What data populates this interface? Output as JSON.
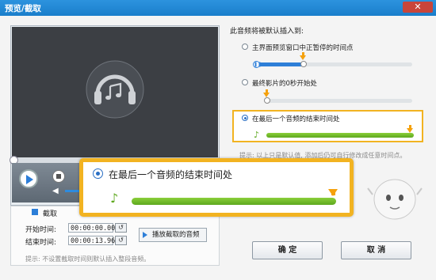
{
  "window": {
    "title": "预览/截取",
    "close_icon": "close-icon"
  },
  "clip": {
    "tab_label": "截取",
    "start_label": "开始时间:",
    "start_value": "00:00:00.000",
    "end_label": "结束时间:",
    "end_value": "00:00:13.960",
    "play_button": "播放截取的音频",
    "hint": "提示: 不设置截取时间则默认插入整段音频。"
  },
  "insert": {
    "section_title": "此音频将被默认插入到:",
    "options": [
      {
        "label": "主界面预览窗口中正暂停的时间点",
        "selected": false
      },
      {
        "label": "最终影片的0秒开始处",
        "selected": false
      },
      {
        "label": "在最后一个音频的结束时间处",
        "selected": true
      }
    ],
    "info_hint": "提示: 以上只是默认值, 添加后仍可自行修改成任意时间点。"
  },
  "zoom": {
    "label": "在最后一个音频的结束时间处"
  },
  "buttons": {
    "ok": "确 定",
    "cancel": "取 消"
  },
  "colors": {
    "accent": "#2c7ed8",
    "highlight": "#f2b321",
    "green": "#5ea81e",
    "arrow": "#f5a10c"
  }
}
